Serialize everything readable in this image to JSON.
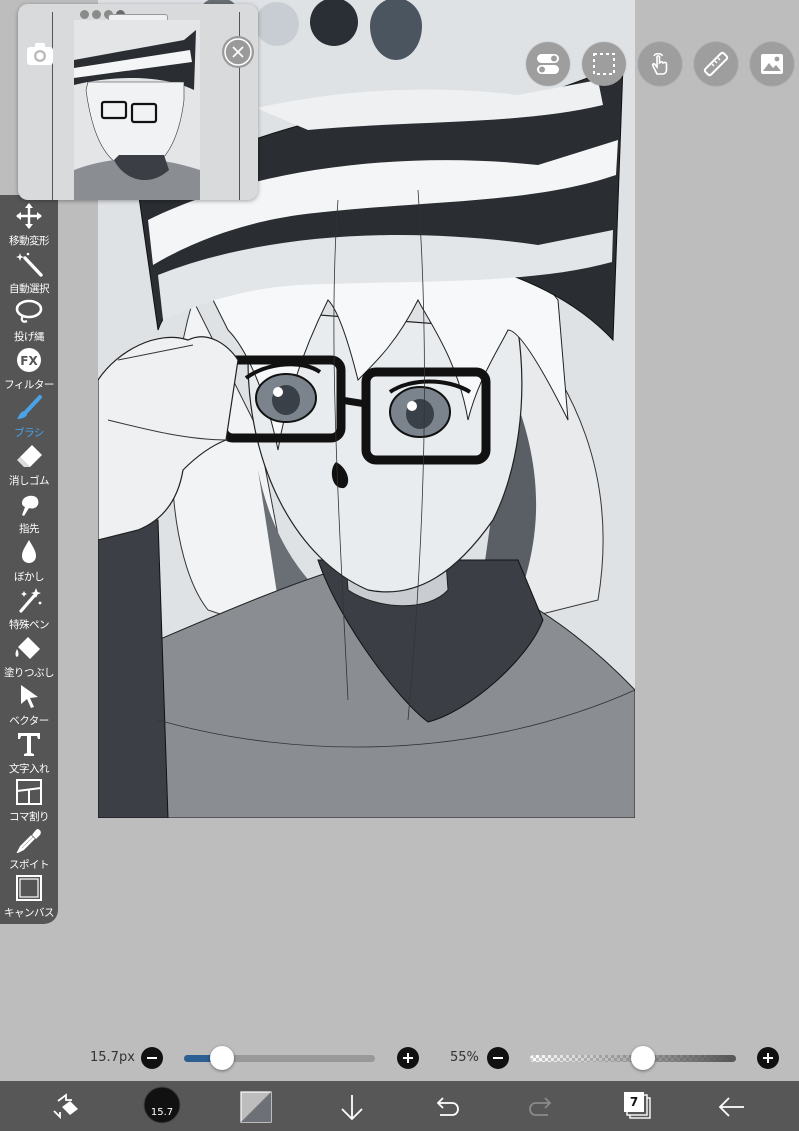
{
  "navigator": {
    "camera_icon": "camera-icon",
    "close_icon": "close-icon",
    "preview_icon": "artwork-thumbnail",
    "dot_colors": [
      "#8a8a8a",
      "#8a8a8a",
      "#8a8a8a",
      "#6a6a6a"
    ]
  },
  "palette": {
    "colors": [
      "#d7dde2",
      "#b9c1c8",
      "#2a2f35",
      "#4b5560"
    ]
  },
  "top_buttons": [
    {
      "name": "toggle-icon"
    },
    {
      "name": "selection-icon"
    },
    {
      "name": "touch-gesture-icon"
    },
    {
      "name": "ruler-icon"
    },
    {
      "name": "image-icon"
    }
  ],
  "tools": [
    {
      "label": "移動変形",
      "icon": "move-icon",
      "active": false
    },
    {
      "label": "自動選択",
      "icon": "magic-wand-icon",
      "active": false
    },
    {
      "label": "投げ縄",
      "icon": "lasso-icon",
      "active": false
    },
    {
      "label": "フィルター",
      "icon": "fx-icon",
      "active": false
    },
    {
      "label": "ブラシ",
      "icon": "brush-icon",
      "active": true
    },
    {
      "label": "消しゴム",
      "icon": "eraser-icon",
      "active": false
    },
    {
      "label": "指先",
      "icon": "smudge-icon",
      "active": false
    },
    {
      "label": "ぼかし",
      "icon": "blur-icon",
      "active": false
    },
    {
      "label": "特殊ペン",
      "icon": "special-pen-icon",
      "active": false
    },
    {
      "label": "塗りつぶし",
      "icon": "fill-icon",
      "active": false
    },
    {
      "label": "ベクター",
      "icon": "vector-icon",
      "active": false
    },
    {
      "label": "文字入れ",
      "icon": "text-icon",
      "active": false
    },
    {
      "label": "コマ割り",
      "icon": "frame-divider-icon",
      "active": false
    },
    {
      "label": "スポイト",
      "icon": "eyedropper-icon",
      "active": false
    },
    {
      "label": "キャンバス",
      "icon": "canvas-icon",
      "active": false
    }
  ],
  "brush_size": {
    "label": "15.7px",
    "fraction": 0.2,
    "accent": "#2b5f91"
  },
  "opacity": {
    "label": "55%",
    "fraction": 0.55
  },
  "bottom_bar": {
    "brush_badge": "15.7",
    "layer_count": "7",
    "icons": [
      "transform-icon",
      "brush-size-icon",
      "color-swatch-icon",
      "download-icon",
      "undo-icon",
      "redo-icon",
      "layers-icon",
      "back-icon"
    ]
  },
  "colors": {
    "toolbar_bg": "#555555",
    "active_tool": "#4aa3e8",
    "bottom_bar_bg": "#575757"
  }
}
